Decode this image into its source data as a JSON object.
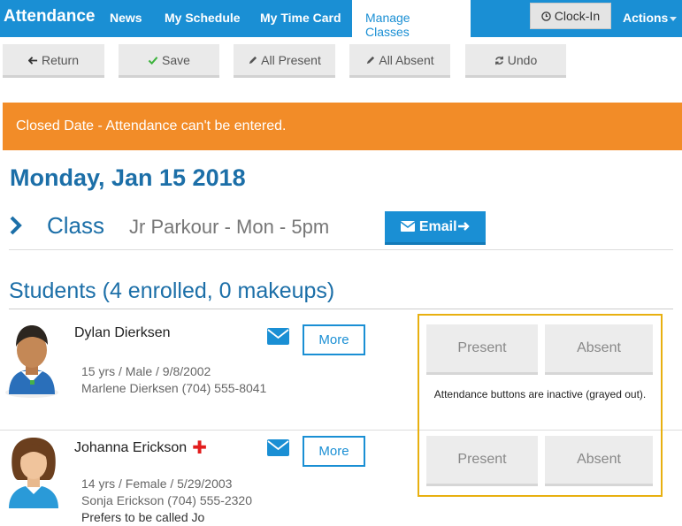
{
  "nav": {
    "brand": "Attendance",
    "links": [
      "News",
      "My Schedule",
      "My Time Card",
      "Manage Classes"
    ],
    "clock_in": "Clock-In",
    "actions": "Actions"
  },
  "toolbar": {
    "return": "Return",
    "save": "Save",
    "all_present": "All Present",
    "all_absent": "All Absent",
    "undo": "Undo"
  },
  "banner": "Closed Date - Attendance can't be entered.",
  "date": "Monday, Jan 15 2018",
  "class": {
    "label": "Class",
    "name": "Jr Parkour - Mon - 5pm",
    "email_button": "Email"
  },
  "students_heading": "Students (4 enrolled, 0 makeups)",
  "students": [
    {
      "name": "Dylan Dierksen",
      "details": "15 yrs / Male / 9/8/2002",
      "guardian": "Marlene Dierksen (704) 555-8041",
      "more": "More",
      "present": "Present",
      "absent": "Absent"
    },
    {
      "name": "Johanna Erickson",
      "details": "14 yrs / Female / 5/29/2003",
      "guardian": "Sonja Erickson (704) 555-2320",
      "note": "Prefers to be called Jo",
      "more": "More",
      "present": "Present",
      "absent": "Absent"
    }
  ],
  "annotation": "Attendance buttons are inactive (grayed out).",
  "colors": {
    "primary": "#1a8fd4",
    "warning": "#f28c28",
    "heading": "#1c6fa8",
    "highlight": "#e8b010"
  }
}
